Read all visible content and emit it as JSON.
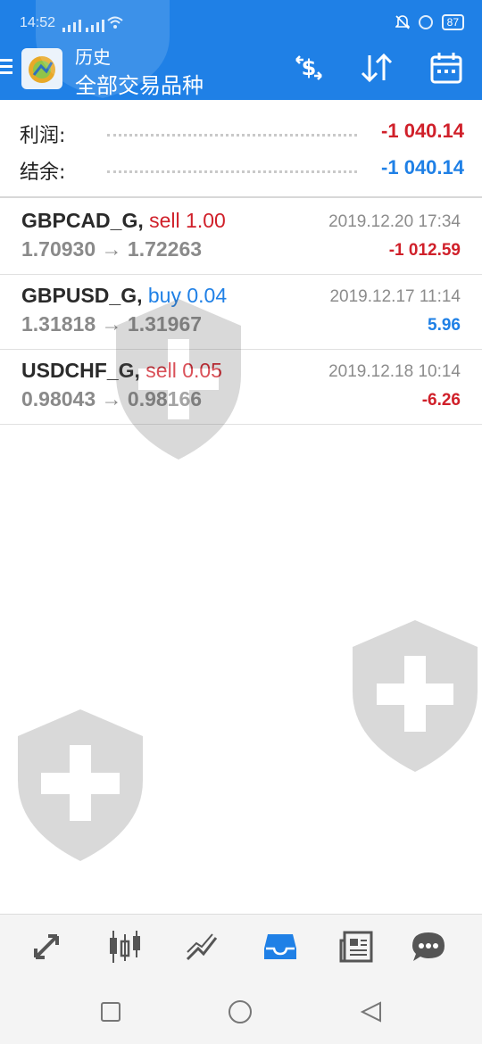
{
  "status_bar": {
    "time": "14:52",
    "battery": "87"
  },
  "app_bar": {
    "subtitle": "历史",
    "title": "全部交易品种",
    "actions": [
      "currency-exchange-icon",
      "sort-arrows-icon",
      "calendar-icon"
    ]
  },
  "summary": {
    "profit_label": "利润:",
    "profit_value": "-1 040.14",
    "balance_label": "结余:",
    "balance_value": "-1 040.14",
    "colors": {
      "negative": "#d0202a",
      "positive": "#1f80e6"
    }
  },
  "deals": [
    {
      "symbol": "GBPCAD_G,",
      "side": "sell 1.00",
      "open_price": "1.70930",
      "close_price": "1.72263",
      "datetime": "2019.12.20 17:34",
      "profit": "-1 012.59"
    },
    {
      "symbol": "GBPUSD_G,",
      "side": "buy 0.04",
      "open_price": "1.31818",
      "close_price": "1.31967",
      "datetime": "2019.12.17 11:14",
      "profit": "5.96"
    },
    {
      "symbol": "USDCHF_G,",
      "side": "sell 0.05",
      "open_price": "0.98043",
      "close_price": "0.98166",
      "datetime": "2019.12.18 10:14",
      "profit": "-6.26"
    }
  ],
  "arrow": "→",
  "bottom_nav": {
    "items": [
      "trade-icon",
      "chart-icon",
      "analytics-icon",
      "history-icon",
      "news-icon",
      "chat-icon"
    ],
    "active": "history-icon",
    "accent": "#1f80e6"
  },
  "system_nav": [
    "recent-apps-icon",
    "home-icon",
    "back-icon"
  ]
}
